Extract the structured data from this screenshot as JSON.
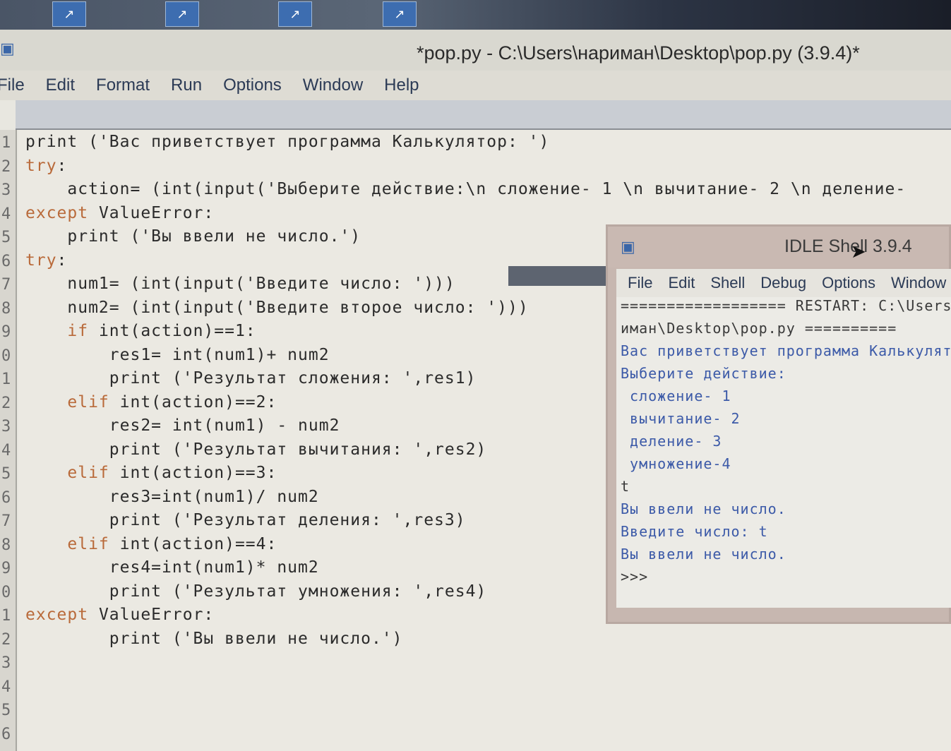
{
  "taskbar": {
    "icons": [
      "shortcut-icon",
      "shortcut-icon",
      "shortcut-icon",
      "shortcut-icon"
    ]
  },
  "window": {
    "title": "*pop.py - C:\\Users\\нариман\\Desktop\\pop.py (3.9.4)*"
  },
  "menubar": {
    "items": [
      "File",
      "Edit",
      "Format",
      "Run",
      "Options",
      "Window",
      "Help"
    ]
  },
  "editor": {
    "line_numbers": [
      "1",
      "2",
      "3",
      "4",
      "5",
      "6",
      "7",
      "8",
      "9",
      "0",
      "1",
      "2",
      "3",
      "4",
      "5",
      "6",
      "7",
      "8",
      "9",
      "0",
      "1",
      "2",
      "3",
      "4",
      "5",
      "6"
    ],
    "lines": [
      {
        "pre": "print ('Вас приветствует программа Калькулятор: ')",
        "kw": "",
        "post": ""
      },
      {
        "pre": "",
        "kw": "try",
        "post": ":"
      },
      {
        "pre": "    action= (int(input('Выберите действие:\\n сложение- 1 \\n вычитание- 2 \\n деление-",
        "kw": "",
        "post": ""
      },
      {
        "pre": "",
        "kw": "except",
        "post": " ValueError:"
      },
      {
        "pre": "    print ('Вы ввели не число.')",
        "kw": "",
        "post": ""
      },
      {
        "pre": "",
        "kw": "try",
        "post": ":"
      },
      {
        "pre": "    num1= (int(input('Введите число: ')))",
        "kw": "",
        "post": ""
      },
      {
        "pre": "    num2= (int(input('Введите второе число: ')))",
        "kw": "",
        "post": ""
      },
      {
        "pre": "    ",
        "kw": "if",
        "post": " int(action)==1:"
      },
      {
        "pre": "        res1= int(num1)+ num2",
        "kw": "",
        "post": ""
      },
      {
        "pre": "        print ('Результат сложения: ',res1)",
        "kw": "",
        "post": ""
      },
      {
        "pre": "    ",
        "kw": "elif",
        "post": " int(action)==2:"
      },
      {
        "pre": "        res2= int(num1) - num2",
        "kw": "",
        "post": ""
      },
      {
        "pre": "        print ('Результат вычитания: ',res2)",
        "kw": "",
        "post": ""
      },
      {
        "pre": "    ",
        "kw": "elif",
        "post": " int(action)==3:"
      },
      {
        "pre": "        res3=int(num1)/ num2",
        "kw": "",
        "post": ""
      },
      {
        "pre": "        print ('Результат деления: ',res3)",
        "kw": "",
        "post": ""
      },
      {
        "pre": "    ",
        "kw": "elif",
        "post": " int(action)==4:"
      },
      {
        "pre": "        res4=int(num1)* num2",
        "kw": "",
        "post": ""
      },
      {
        "pre": "        print ('Результат умножения: ',res4)",
        "kw": "",
        "post": ""
      },
      {
        "pre": "",
        "kw": "except",
        "post": " ValueError:"
      },
      {
        "pre": "        print ('Вы ввели не число.')",
        "kw": "",
        "post": ""
      }
    ]
  },
  "shell": {
    "title": "IDLE Shell 3.9.4",
    "menu": [
      "File",
      "Edit",
      "Shell",
      "Debug",
      "Options",
      "Window"
    ],
    "lines": [
      {
        "text": "================== RESTART: C:\\Users\\нар",
        "cls": "out-dark"
      },
      {
        "text": "иман\\Desktop\\pop.py ==========",
        "cls": "out-dark"
      },
      {
        "text": "Вас приветствует программа Калькулятор:",
        "cls": "out-blue"
      },
      {
        "text": "Выберите действие:",
        "cls": "out-blue"
      },
      {
        "text": " сложение- 1",
        "cls": "out-blue"
      },
      {
        "text": " вычитание- 2",
        "cls": "out-blue"
      },
      {
        "text": " деление- 3",
        "cls": "out-blue"
      },
      {
        "text": " умножение-4",
        "cls": "out-blue"
      },
      {
        "text": "t",
        "cls": "out-dark"
      },
      {
        "text": "Вы ввели не число.",
        "cls": "out-blue"
      },
      {
        "text": "Введите число: t",
        "cls": "out-blue"
      },
      {
        "text": "Вы ввели не число.",
        "cls": "out-blue"
      },
      {
        "text": ">>>",
        "cls": "out-dark"
      }
    ]
  }
}
